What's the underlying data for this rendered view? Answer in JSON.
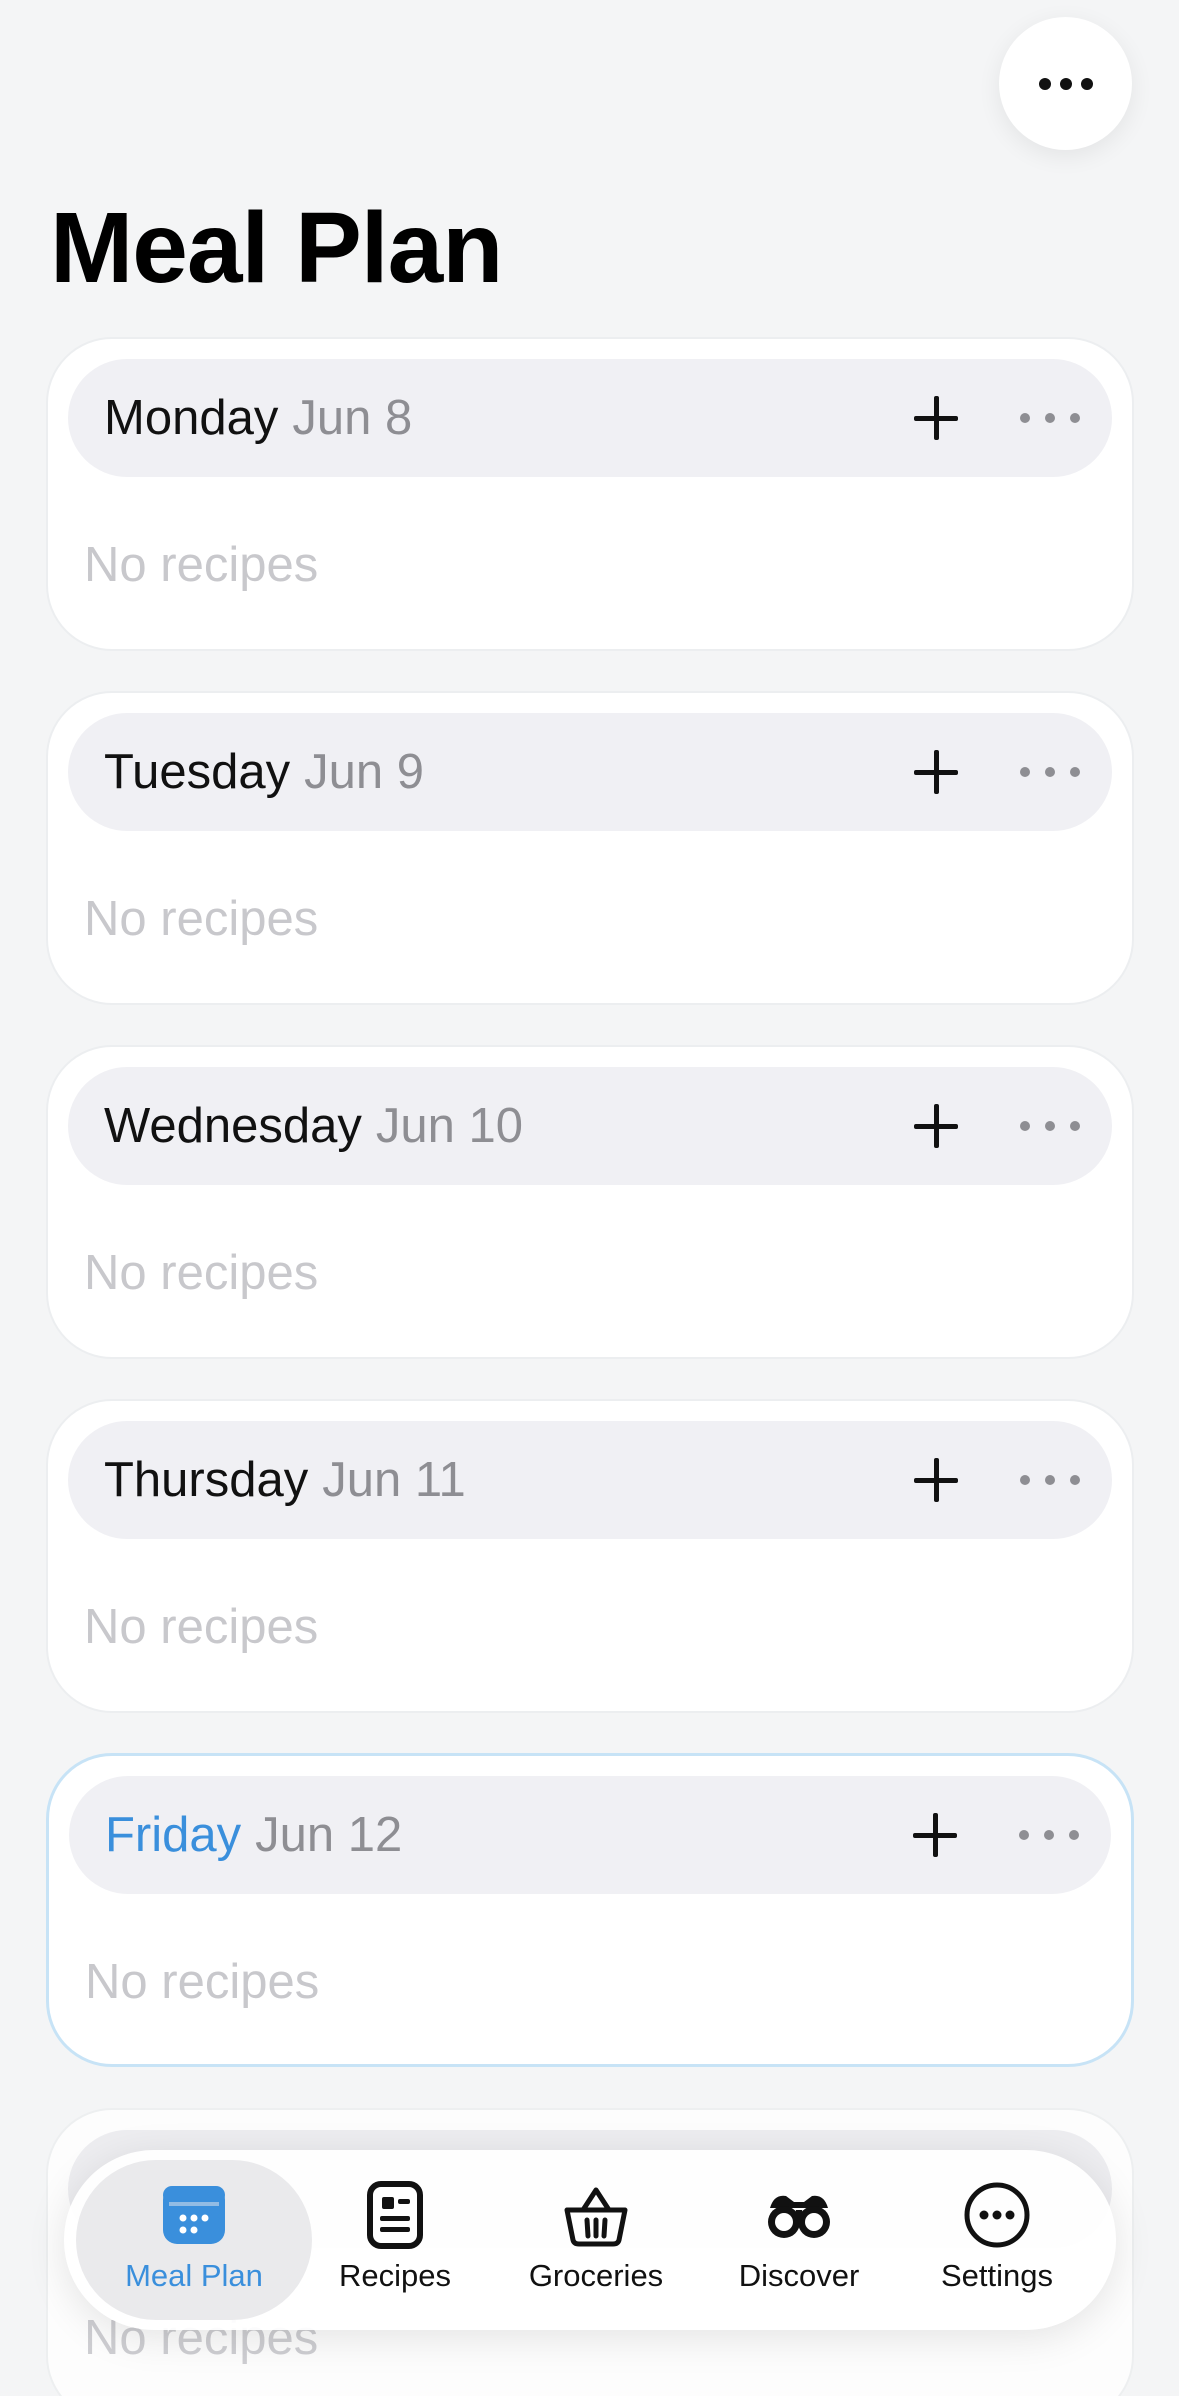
{
  "header": {
    "more_icon": "ellipsis-icon",
    "title": "Meal Plan"
  },
  "days": [
    {
      "name": "Monday",
      "date": "Jun 8",
      "empty": "No recipes"
    },
    {
      "name": "Tuesday",
      "date": "Jun 9",
      "empty": "No recipes"
    },
    {
      "name": "Wednesday",
      "date": "Jun 10",
      "empty": "No recipes"
    },
    {
      "name": "Thursday",
      "date": "Jun 11",
      "empty": "No recipes"
    },
    {
      "name": "Friday",
      "date": "Jun 12",
      "empty": "No recipes",
      "today": true
    }
  ],
  "partial_day": {
    "empty": "No recipes"
  },
  "tabbar": {
    "tabs": [
      {
        "label": "Meal Plan",
        "icon": "calendar-icon",
        "active": true
      },
      {
        "label": "Recipes",
        "icon": "recipe-card-icon"
      },
      {
        "label": "Groceries",
        "icon": "basket-icon"
      },
      {
        "label": "Discover",
        "icon": "binoculars-icon"
      },
      {
        "label": "Settings",
        "icon": "ellipsis-circle-icon"
      }
    ]
  },
  "colors": {
    "accent": "#3a8fdc",
    "today_border": "#c7e3f6",
    "secondary_text": "#8e8e93",
    "placeholder_text": "#c8c8cc",
    "background": "#f4f5f6"
  }
}
